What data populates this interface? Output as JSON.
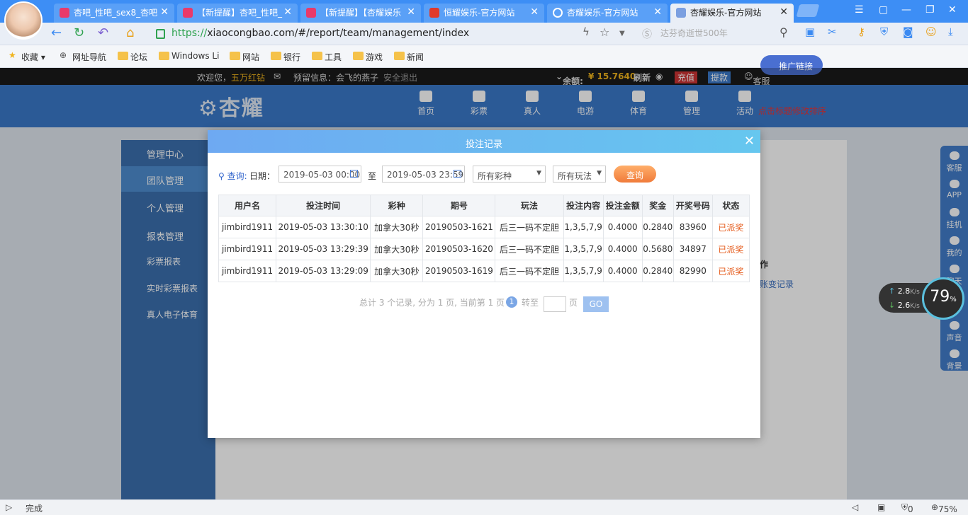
{
  "browser": {
    "tabs": [
      {
        "label": "杏吧_性吧_sex8_杏吧"
      },
      {
        "label": "【新提醒】杏吧_性吧_"
      },
      {
        "label": "【新提醒】【杏耀娱乐"
      },
      {
        "label": "恒耀娱乐-官方网站"
      },
      {
        "label": "杏耀娱乐-官方网站"
      },
      {
        "label": "杏耀娱乐-官方网站"
      }
    ],
    "url_scheme": "https://",
    "url_rest": "xiaocongbao.com/#/report/team/management/index",
    "search_hint": "达芬奇逝世500年",
    "bookmarks": [
      "收藏",
      "网址导航",
      "论坛",
      "Windows Li",
      "网站",
      "银行",
      "工具",
      "游戏",
      "新闻"
    ],
    "status_text": "完成",
    "zoom": "75%",
    "status_count": "0"
  },
  "site": {
    "welcome": "欢迎您，",
    "username": "五万红钻",
    "reserve_info": "预留信息：会飞的燕子",
    "logout": "安全退出",
    "balance_label": "余额:",
    "balance": "¥ 15.7640",
    "refresh": "刷新",
    "recharge": "充值",
    "withdraw": "提款",
    "service": "客服",
    "logo": "杏耀",
    "nav": [
      "首页",
      "彩票",
      "真人",
      "电游",
      "体育",
      "管理",
      "活动"
    ],
    "left_nav": [
      {
        "label": "管理中心"
      },
      {
        "label": "团队管理"
      },
      {
        "label": "个人管理"
      },
      {
        "label": "报表管理"
      },
      {
        "label": "彩票报表"
      },
      {
        "label": "实时彩票报表"
      },
      {
        "label": "真人电子体育"
      }
    ],
    "promo_link": "推广链接",
    "red_tip": "点击标题修改排序",
    "op_header": "作",
    "op_link": "账变记录",
    "side_tools": [
      "客服",
      "APP",
      "挂机",
      "我的",
      "聊天",
      "声音",
      "背景"
    ]
  },
  "speed_widget": {
    "up": "2.8",
    "down": "2.6",
    "unit": "K/s",
    "percent": "79",
    "percent_sign": "%"
  },
  "modal": {
    "title": "投注记录",
    "query_label": "查询:",
    "date_label": "日期：",
    "date_from": "2019-05-03 00:00",
    "to_label": "至",
    "date_to": "2019-05-03 23:59",
    "lottery_select": "所有彩种",
    "play_select": "所有玩法",
    "query_button": "查询",
    "columns": [
      "用户名",
      "投注时间",
      "彩种",
      "期号",
      "玩法",
      "投注内容",
      "投注金额",
      "奖金",
      "开奖号码",
      "状态"
    ],
    "rows": [
      [
        "jimbird1911",
        "2019-05-03 13:30:10",
        "加拿大30秒",
        "20190503-1621",
        "后三一码不定胆",
        "1,3,5,7,9",
        "0.4000",
        "0.2840",
        "83960",
        "已派奖"
      ],
      [
        "jimbird1911",
        "2019-05-03 13:29:39",
        "加拿大30秒",
        "20190503-1620",
        "后三一码不定胆",
        "1,3,5,7,9",
        "0.4000",
        "0.5680",
        "34897",
        "已派奖"
      ],
      [
        "jimbird1911",
        "2019-05-03 13:29:09",
        "加拿大30秒",
        "20190503-1619",
        "后三一码不定胆",
        "1,3,5,7,9",
        "0.4000",
        "0.2840",
        "82990",
        "已派奖"
      ]
    ],
    "pager_summary": "总计 3 个记录, 分为 1 页, 当前第 1 页",
    "pager_current": "1",
    "pager_goto": "转至",
    "pager_page": "页",
    "pager_go": "GO"
  }
}
